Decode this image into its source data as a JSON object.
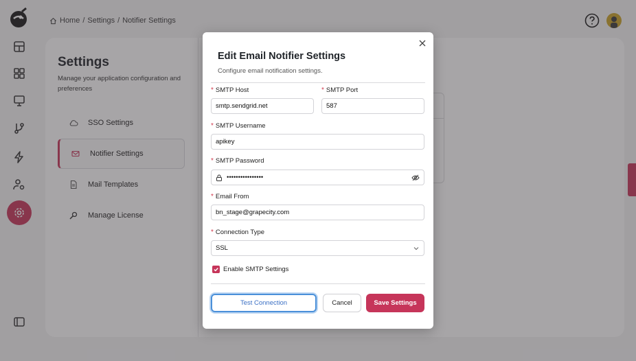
{
  "breadcrumb": {
    "home": "Home",
    "separator": "/",
    "settings": "Settings",
    "current": "Notifier Settings"
  },
  "settings_panel": {
    "title": "Settings",
    "description": "Manage your application configuration and preferences",
    "items": [
      {
        "label": "SSO Settings",
        "icon": "cloud-icon"
      },
      {
        "label": "Notifier Settings",
        "icon": "mail-icon",
        "active": true
      },
      {
        "label": "Mail Templates",
        "icon": "file-icon"
      },
      {
        "label": "Manage License",
        "icon": "key-icon"
      }
    ]
  },
  "modal": {
    "title": "Edit Email Notifier Settings",
    "subtitle": "Configure email notification settings.",
    "required_mark": "*",
    "smtp_host": {
      "label": "SMTP Host",
      "value": "smtp.sendgrid.net"
    },
    "smtp_port": {
      "label": "SMTP Port",
      "value": "587"
    },
    "smtp_username": {
      "label": "SMTP Username",
      "value": "apikey"
    },
    "smtp_password": {
      "label": "SMTP Password",
      "value": "••••••••••••••••"
    },
    "email_from": {
      "label": "Email From",
      "value": "bn_stage@grapecity.com"
    },
    "connection_type": {
      "label": "Connection Type",
      "value": "SSL"
    },
    "enable_smtp": {
      "label": "Enable SMTP Settings",
      "checked": true
    },
    "buttons": {
      "test": "Test Connection",
      "cancel": "Cancel",
      "save": "Save Settings"
    }
  },
  "colors": {
    "accent": "#c6355a",
    "focus": "#4a90d9"
  }
}
